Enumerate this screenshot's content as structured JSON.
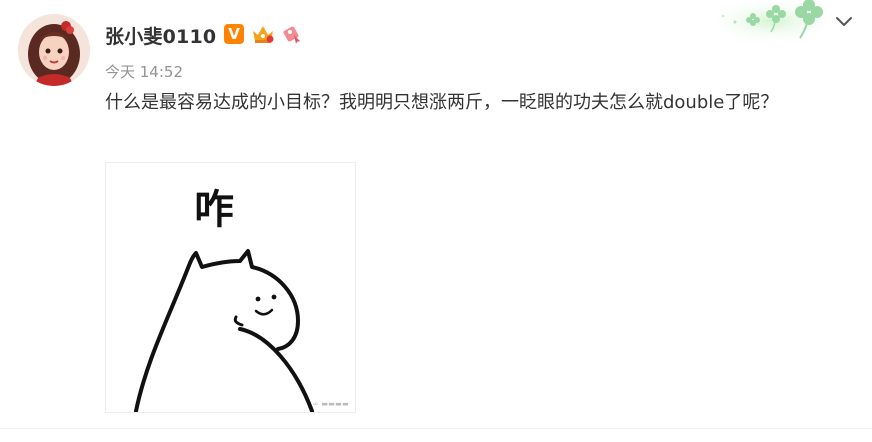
{
  "post": {
    "username": "张小斐0110",
    "timestamp": "今天 14:52",
    "text": "什么是最容易达成的小目标？我明明只想涨两斤，一眨眼的功夫怎么就double了呢？",
    "image_caption": "咋"
  },
  "icons": {
    "vip_badge": "V",
    "crown_badge": "crown-icon",
    "fan_badge": "ribbon-icon",
    "more": "chevron-down-icon"
  },
  "colors": {
    "vip": "#ff8200",
    "crown": "#f7a11b",
    "clover": "#9ad8a3",
    "text": "#333333",
    "muted": "#939393"
  }
}
